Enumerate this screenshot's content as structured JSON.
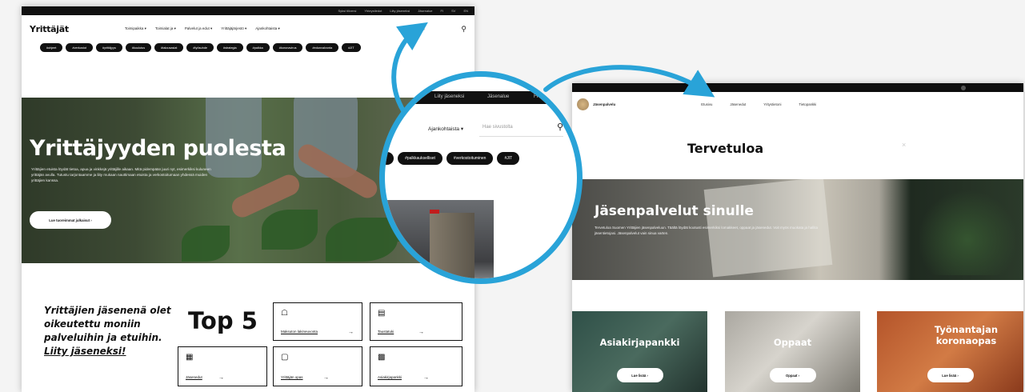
{
  "left": {
    "topbar": [
      "Syksi tiliversi",
      "Yhteystiedot",
      "Liity jäseneksi",
      "Jäsenalue",
      "FI",
      "SV",
      "EN"
    ],
    "logo": "Yrittäjät",
    "menu": [
      "Toimipaikka ▾",
      "Toimialat ja ▾",
      "Palvelut ja edut ▾",
      "Yrittäjäjärjestö ▾",
      "Ajankohtaista ▾"
    ],
    "search_placeholder": "Hae",
    "tags": [
      "#ohjeet",
      "#verkostot",
      "#yrittäjyys",
      "#koulutus",
      "#talousasiat",
      "#työsuhde",
      "#strategia",
      "#palkka",
      "#koronavirus",
      "#edunvalvonta",
      "#JIT"
    ],
    "hero": {
      "title": "Yrittäjyyden puolesta",
      "text": "Yrittäjien etuista löydät tietoa, apua ja vinkkejä yrittäjille aikaan. Mitä pidempään juuri nyt, esimerkiksi kuluneen yrittäjän avulla. Tutustu tarjontaamme ja liity mukaan nauttimaan etuista ja verkostoitumaan yhdessä muiden yrittäjien kanssa.",
      "button": "Lue tuoreimmat julkaisut ›"
    },
    "member_text": "Yrittäjien jäsenenä olet oikeutettu moniin palveluihin ja etuihin.",
    "member_link": "Liity jäseneksi!",
    "top5_title": "Top 5",
    "top5": [
      {
        "icon": "☖",
        "label": "Maksuton lakineuvonta"
      },
      {
        "icon": "▤",
        "label": "Taustatuki"
      },
      {
        "icon": "▦",
        "label": "Jäsenedut"
      },
      {
        "icon": "▢",
        "label": "Yrittäjän opas"
      },
      {
        "icon": "▩",
        "label": "Asiakirjapankki"
      }
    ]
  },
  "zoom": {
    "topbar": [
      "Liity jäseneksi",
      "Jäsenalue",
      "FI"
    ],
    "menu": "Ajankohtaista ▾",
    "search_placeholder": "Hae sivustolta",
    "tags": [
      "#pikakeksinnot",
      "#palkkaukselliset",
      "#verkostoituminen",
      "#JIT"
    ]
  },
  "right": {
    "brand": "Jäsenpalvelu",
    "menu": [
      "Etusivu",
      "Jäsenedut",
      "Yritystietoni",
      "Tietopankki"
    ],
    "title": "Tervetuloa",
    "close": "×",
    "hero": {
      "title": "Jäsenpalvelut sinulle",
      "text": "Tervetuloa Suomen Yrittäjien jäsenpalveluun. Täältä löydät kootusti esimerkiksi lomakkeet, oppaat ja jäsenedut. Voit myös muokata ja hallita jäsentietojasi. Jäsenpalvelut vain sinua varten."
    },
    "cards": [
      {
        "title": "Asiakirjapankki",
        "button": "Lue lisää ›"
      },
      {
        "title": "Oppaat",
        "button": "Oppaat ›"
      },
      {
        "title": "Työnantajan koronaopas",
        "button": "Lue lisää ›"
      }
    ]
  },
  "colors": {
    "accent": "#29a3d8",
    "dark": "#111111"
  }
}
